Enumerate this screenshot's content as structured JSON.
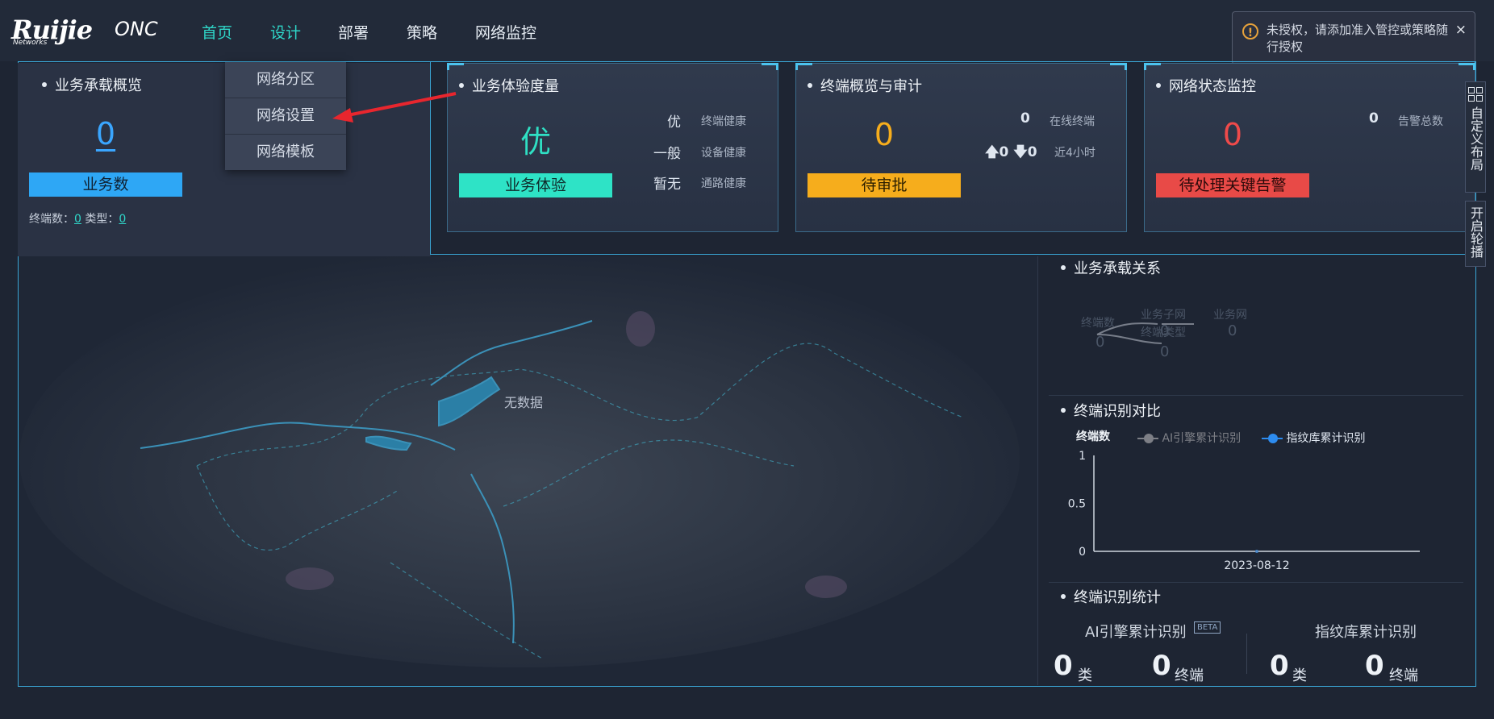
{
  "header": {
    "brand": "Ruijie",
    "brand_sub": "Networks",
    "product": "ONC",
    "nav": [
      "首页",
      "设计",
      "部署",
      "策略",
      "网络监控"
    ]
  },
  "design_menu": [
    "网络分区",
    "网络设置",
    "网络模板"
  ],
  "toast": {
    "icon": "!",
    "message": "未授权，请添加准入管控或策略随行授权",
    "close": "×"
  },
  "business_overview": {
    "title": "业务承载概览",
    "count": "0",
    "label": "业务数",
    "terminal_label": "终端数：",
    "terminal_value": "0",
    "type_label": "类型：",
    "type_value": "0"
  },
  "experience": {
    "title": "业务体验度量",
    "grade": "优",
    "label": "业务体验",
    "rows": [
      {
        "value": "优",
        "name": "终端健康"
      },
      {
        "value": "一般",
        "name": "设备健康"
      },
      {
        "value": "暂无",
        "name": "通路健康"
      }
    ]
  },
  "terminal_audit": {
    "title": "终端概览与审计",
    "pending": "0",
    "label": "待审批",
    "online_value": "0",
    "online_label": "在线终端",
    "up_value": "0",
    "down_value": "0",
    "period_label": "近4小时"
  },
  "network_status": {
    "title": "网络状态监控",
    "critical": "0",
    "label": "待处理关键告警",
    "alarm_value": "0",
    "alarm_label": "告警总数"
  },
  "map": {
    "no_data": "无数据"
  },
  "relation": {
    "title": "业务承载关系",
    "nodes": [
      {
        "name": "终端数",
        "value": "0"
      },
      {
        "name": "业务子网",
        "value": "0"
      },
      {
        "name": "终端类型",
        "value": "0"
      },
      {
        "name": "业务网",
        "value": "0"
      }
    ]
  },
  "identify_compare": {
    "title": "终端识别对比",
    "chart_data": {
      "type": "line",
      "ylabel": "终端数",
      "x": [
        "2023-08-12"
      ],
      "yticks": [
        "1",
        "0.5",
        "0"
      ],
      "ylim": [
        0,
        1
      ],
      "series": [
        {
          "name": "AI引擎累计识别",
          "color": "#7d7f86",
          "values": [
            0
          ]
        },
        {
          "name": "指纹库累计识别",
          "color": "#2d8cf0",
          "values": [
            0
          ]
        }
      ]
    }
  },
  "identify_stats": {
    "title": "终端识别统计",
    "ai_label": "AI引擎累计识别",
    "beta": "BETA",
    "fp_label": "指纹库累计识别",
    "ai_class": "0",
    "ai_terminal": "0",
    "fp_class": "0",
    "fp_terminal": "0",
    "unit_class": "类",
    "unit_terminal": "终端"
  },
  "side_buttons": [
    "自定义布局",
    "开启轮播"
  ]
}
